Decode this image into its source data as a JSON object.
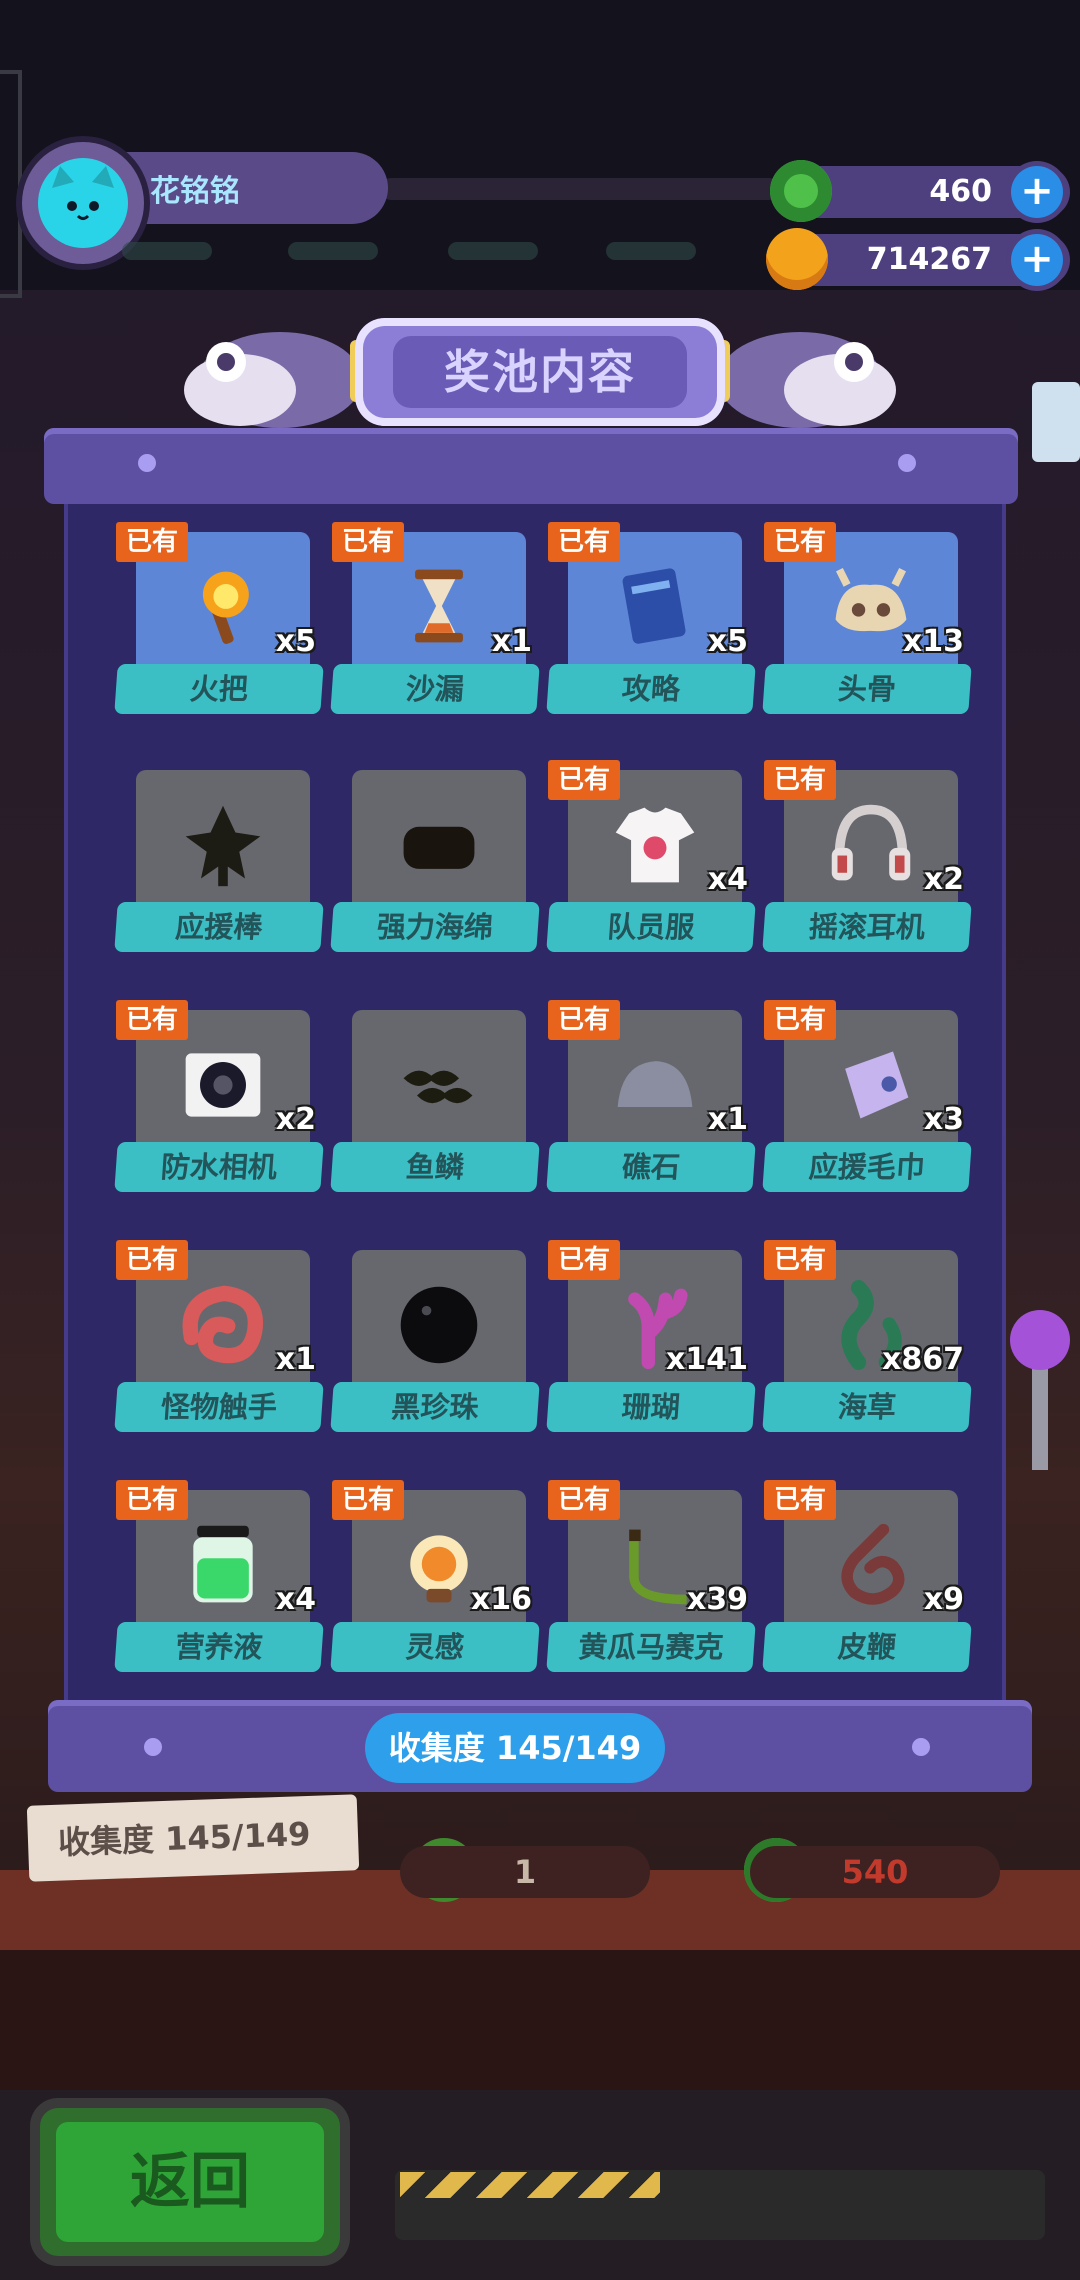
{
  "player": {
    "name": "花铭铭"
  },
  "currencies": [
    {
      "name": "gem-coin",
      "value": "460",
      "color": "#4fc14a"
    },
    {
      "name": "gold-coin",
      "value": "714267",
      "color": "#f3a21b"
    }
  ],
  "panel": {
    "title": "奖池内容",
    "collection_badge": "收集度  145/149"
  },
  "owned_tag": "已有",
  "items": [
    {
      "name": "火把",
      "qty": "x5",
      "owned": true,
      "icon": "torch-icon"
    },
    {
      "name": "沙漏",
      "qty": "x1",
      "owned": true,
      "icon": "hourglass-icon"
    },
    {
      "name": "攻略",
      "qty": "x5",
      "owned": true,
      "icon": "book-icon"
    },
    {
      "name": "头骨",
      "qty": "x13",
      "owned": true,
      "icon": "skull-icon"
    },
    {
      "name": "应援棒",
      "qty": "",
      "owned": false,
      "icon": "cheer-stick-icon"
    },
    {
      "name": "强力海绵",
      "qty": "",
      "owned": false,
      "icon": "sponge-icon"
    },
    {
      "name": "队员服",
      "qty": "x4",
      "owned": true,
      "icon": "tshirt-icon"
    },
    {
      "name": "摇滚耳机",
      "qty": "x2",
      "owned": true,
      "icon": "headphones-icon"
    },
    {
      "name": "防水相机",
      "qty": "x2",
      "owned": true,
      "icon": "camera-icon"
    },
    {
      "name": "鱼鳞",
      "qty": "",
      "owned": false,
      "icon": "fish-scale-icon"
    },
    {
      "name": "礁石",
      "qty": "x1",
      "owned": true,
      "icon": "rock-icon"
    },
    {
      "name": "应援毛巾",
      "qty": "x3",
      "owned": true,
      "icon": "towel-icon"
    },
    {
      "name": "怪物触手",
      "qty": "x1",
      "owned": true,
      "icon": "tentacle-icon"
    },
    {
      "name": "黑珍珠",
      "qty": "",
      "owned": false,
      "icon": "black-pearl-icon"
    },
    {
      "name": "珊瑚",
      "qty": "x141",
      "owned": true,
      "icon": "coral-icon"
    },
    {
      "name": "海草",
      "qty": "x867",
      "owned": true,
      "icon": "seaweed-icon"
    },
    {
      "name": "营养液",
      "qty": "x4",
      "owned": true,
      "icon": "nutrient-jar-icon"
    },
    {
      "name": "灵感",
      "qty": "x16",
      "owned": true,
      "icon": "lightbulb-icon"
    },
    {
      "name": "黄瓜马赛克",
      "qty": "x39",
      "owned": true,
      "icon": "cucumber-icon"
    },
    {
      "name": "皮鞭",
      "qty": "x9",
      "owned": true,
      "icon": "whip-icon"
    }
  ],
  "scene": {
    "collection_sign": "收集度  145/149",
    "stat_left": "1",
    "stat_right": "540"
  },
  "buttons": {
    "back": "返回"
  }
}
